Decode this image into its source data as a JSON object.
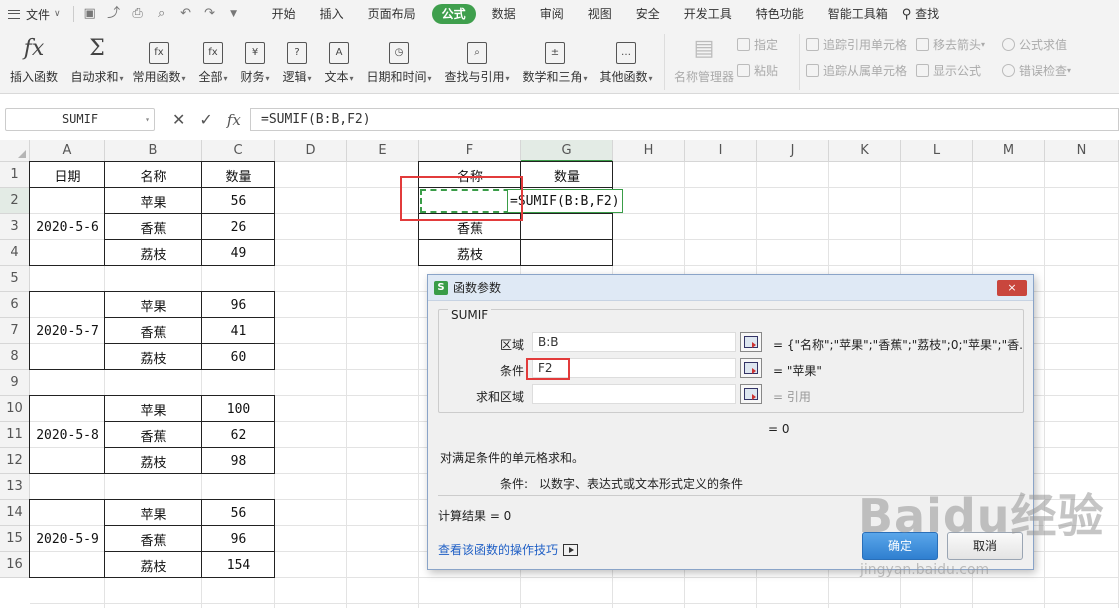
{
  "menubar": {
    "file": "文件",
    "tabs": [
      "开始",
      "插入",
      "页面布局",
      "公式",
      "数据",
      "审阅",
      "视图",
      "安全",
      "开发工具",
      "特色功能",
      "智能工具箱"
    ],
    "active_tab": "公式",
    "search": "查找",
    "accent_color": "#3f9f4d"
  },
  "ribbon": {
    "insert_func": "插入函数",
    "autosum": "自动求和",
    "common_func": "常用函数",
    "all": "全部",
    "finance": "财务",
    "logic": "逻辑",
    "text": "文本",
    "datetime": "日期和时间",
    "lookup": "查找与引用",
    "math": "数学和三角",
    "other": "其他函数",
    "name_mgr": "名称管理器",
    "specify": "指定",
    "paste": "粘贴",
    "trace_precedents": "追踪引用单元格",
    "trace_dependents": "追踪从属单元格",
    "remove_arrows": "移去箭头",
    "show_formula": "显示公式",
    "formula_eval": "公式求值",
    "error_check": "错误检查"
  },
  "formula_bar": {
    "name_box": "SUMIF",
    "formula": "=SUMIF(B:B,F2)"
  },
  "sheet": {
    "columns": [
      "A",
      "B",
      "C",
      "D",
      "E",
      "F",
      "G",
      "H",
      "I",
      "J",
      "K",
      "L",
      "M",
      "N"
    ],
    "rows": [
      "1",
      "2",
      "3",
      "4",
      "5",
      "6",
      "7",
      "8",
      "9",
      "10",
      "11",
      "12",
      "13",
      "14",
      "15",
      "16"
    ],
    "left_table": {
      "headers": [
        "日期",
        "名称",
        "数量"
      ],
      "groups": [
        {
          "date": "2020-5-6",
          "items": [
            [
              "苹果",
              "56"
            ],
            [
              "香蕉",
              "26"
            ],
            [
              "荔枝",
              "49"
            ]
          ]
        },
        {
          "date": "2020-5-7",
          "items": [
            [
              "苹果",
              "96"
            ],
            [
              "香蕉",
              "41"
            ],
            [
              "荔枝",
              "60"
            ]
          ]
        },
        {
          "date": "2020-5-8",
          "items": [
            [
              "苹果",
              "100"
            ],
            [
              "香蕉",
              "62"
            ],
            [
              "荔枝",
              "98"
            ]
          ]
        },
        {
          "date": "2020-5-9",
          "items": [
            [
              "苹果",
              "56"
            ],
            [
              "香蕉",
              "96"
            ],
            [
              "荔枝",
              "154"
            ]
          ]
        }
      ]
    },
    "right_table": {
      "headers": [
        "名称",
        "数量"
      ],
      "names": [
        "",
        "香蕉",
        "荔枝"
      ],
      "editing_formula": "=SUMIF(B:B,F2)"
    }
  },
  "dialog": {
    "title": "函数参数",
    "close": "×",
    "func_name": "SUMIF",
    "args": [
      {
        "label": "区域",
        "value": "B:B",
        "result": "= {\"名称\";\"苹果\";\"香蕉\";\"荔枝\";0;\"苹果\";\"香..."
      },
      {
        "label": "条件",
        "value": "F2",
        "result": "= \"苹果\""
      },
      {
        "label": "求和区域",
        "value": "",
        "result": "= 引用"
      }
    ],
    "eq_result": "=  0",
    "description": "对满足条件的单元格求和。",
    "arg_desc_label": "条件:",
    "arg_desc": "以数字、表达式或文本形式定义的条件",
    "calc_result": "计算结果  =  0",
    "help_link": "查看该函数的操作技巧",
    "ok": "确定",
    "cancel": "取消"
  },
  "watermark": {
    "text": "Baidu经验",
    "sub": "jingyan.baidu.com"
  }
}
